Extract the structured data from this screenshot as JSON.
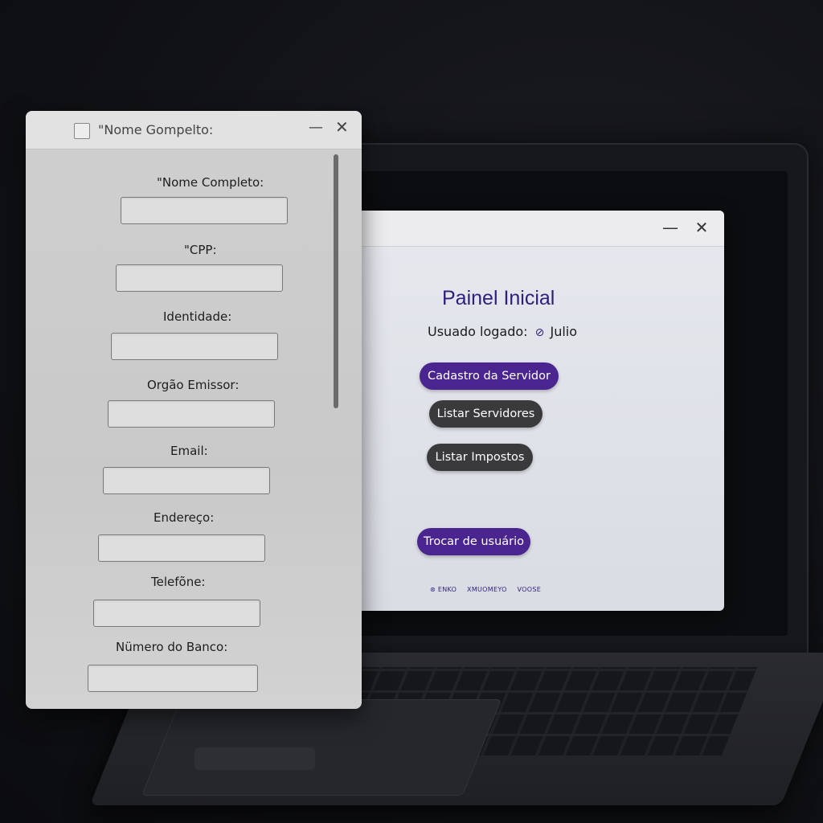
{
  "dashboard": {
    "title": "Painel Inicial",
    "user_label": "Usuado logado:",
    "user_icon": "user-icon",
    "user_name": "Julio",
    "buttons": {
      "cadastro": "Cadastro da Servidor",
      "listar_servidores": "Listar Servidores",
      "listar_impostos": "Listar Impostos",
      "trocar_usuario": "Trocar de usuário"
    },
    "window_controls": {
      "minimize": "—",
      "close": "✕"
    },
    "footer": [
      "⊛ ENKO",
      "XMUOMEYO",
      "VOOSE"
    ]
  },
  "form": {
    "title": "\"Nome Gompelto:",
    "window_controls": {
      "minimize": "—",
      "close": "✕"
    },
    "fields": [
      {
        "label": "\"Nome Completo:",
        "value": ""
      },
      {
        "label": "\"CPP:",
        "value": ""
      },
      {
        "label": "Identidade:",
        "value": ""
      },
      {
        "label": "Orgão Emissor:",
        "value": ""
      },
      {
        "label": "Email:",
        "value": ""
      },
      {
        "label": "Endereço:",
        "value": ""
      },
      {
        "label": "Telefõne:",
        "value": ""
      },
      {
        "label": "Nümero do Banco:",
        "value": ""
      }
    ]
  },
  "colors": {
    "accent": "#4a2590",
    "dark_button": "#3a3a3d",
    "title_text": "#2e1f7a"
  }
}
